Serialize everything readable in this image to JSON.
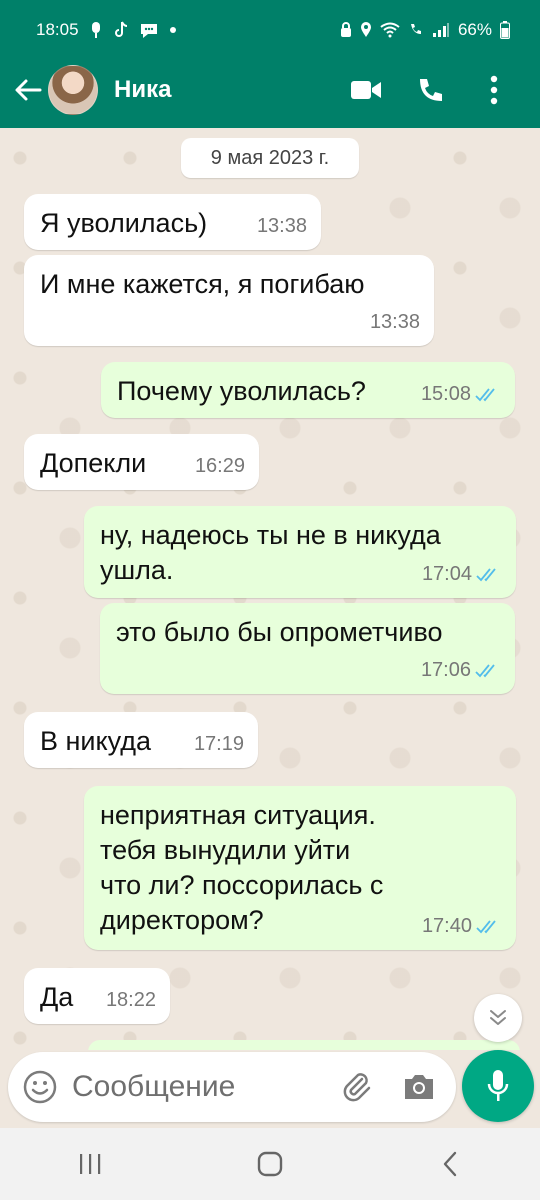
{
  "status_bar": {
    "time": "18:05",
    "battery": "66%",
    "icons_left": [
      "voicemail-icon",
      "tiktok-icon",
      "message-icon",
      "dot-icon"
    ],
    "icons_right": [
      "security-icon",
      "location-icon",
      "wifi-icon",
      "wifi-calling-icon",
      "signal-icon",
      "battery-icon"
    ]
  },
  "appbar": {
    "contact_name": "Ника",
    "icons": [
      "back-arrow-icon",
      "video-call-icon",
      "voice-call-icon",
      "more-vertical-icon"
    ]
  },
  "chat": {
    "date_chip": "9 мая 2023 г.",
    "messages": [
      {
        "dir": "in",
        "text": "Я уволилась)",
        "time": "13:38"
      },
      {
        "dir": "in",
        "text": "И мне кажется, я погибаю",
        "time": "13:38"
      },
      {
        "dir": "out",
        "text": "Почему уволилась?",
        "time": "15:08",
        "status": "read"
      },
      {
        "dir": "in",
        "text": "Допекли",
        "time": "16:29"
      },
      {
        "dir": "out",
        "text": "ну, надеюсь ты не в никуда\nушла.",
        "time": "17:04",
        "status": "read"
      },
      {
        "dir": "out",
        "text": "это было бы опрометчиво",
        "time": "17:06",
        "status": "read"
      },
      {
        "dir": "in",
        "text": "В никуда",
        "time": "17:19"
      },
      {
        "dir": "out",
        "text": "неприятная ситуация.\nтебя вынудили уйти\nчто ли? поссорилась с\nдиректором?",
        "time": "17:40",
        "status": "read"
      },
      {
        "dir": "in",
        "text": "Да",
        "time": "18:22"
      }
    ]
  },
  "composer": {
    "placeholder": "Сообщение",
    "icons": [
      "emoji-icon",
      "attach-icon",
      "camera-icon",
      "mic-icon"
    ]
  },
  "colors": {
    "header": "#008069",
    "outgoing_bubble": "#e7ffdb",
    "incoming_bubble": "#ffffff",
    "read_ticks": "#53bdeb",
    "mic_button": "#00a884"
  },
  "nav": {
    "icons": [
      "recent-apps-icon",
      "home-icon",
      "back-icon"
    ]
  }
}
